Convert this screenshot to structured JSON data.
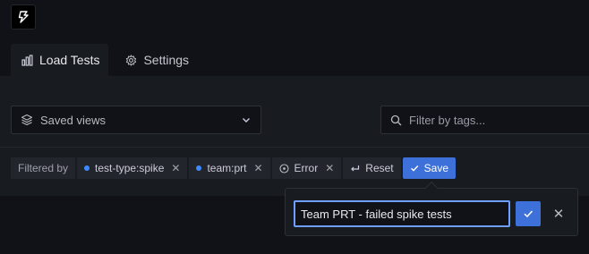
{
  "app": {
    "logo_icon": "k6-logo-icon"
  },
  "tabs": [
    {
      "label": "Load Tests",
      "icon": "bar-chart-icon",
      "active": true
    },
    {
      "label": "Settings",
      "icon": "cog-icon",
      "active": false
    }
  ],
  "views": {
    "label": "Saved views",
    "icon": "layers-icon"
  },
  "search": {
    "placeholder": "Filter by tags..."
  },
  "filters": {
    "label": "Filtered by",
    "chips": [
      {
        "label": "test-type:spike",
        "dot_color": "#3d8bfd"
      },
      {
        "label": "team:prt",
        "dot_color": "#3d8bfd"
      },
      {
        "label": "Error",
        "icon": "circle-x-icon"
      }
    ],
    "reset_label": "Reset",
    "save_label": "Save"
  },
  "save_popup": {
    "name_value": "Team PRT - failed spike tests"
  },
  "colors": {
    "accent": "#3d71d9",
    "focus": "#6e9fff",
    "background": "#111217",
    "panel": "#181b1f"
  }
}
